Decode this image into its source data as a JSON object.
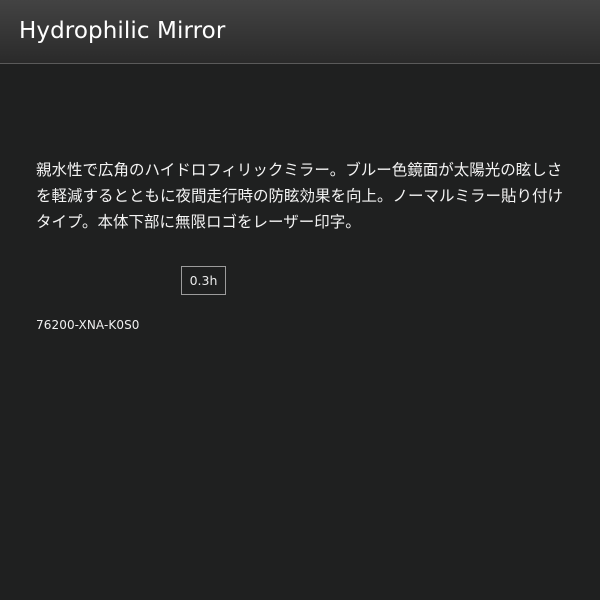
{
  "header": {
    "title": "Hydrophilic Mirror"
  },
  "product": {
    "description": "親水性で広角のハイドロフィリックミラー。ブルー色鏡面が太陽光の眩しさを軽減するとともに夜間走行時の防眩効果を向上。ノーマルミラー貼り付けタイプ。本体下部に無限ロゴをレーザー印字。",
    "time": "0.3h",
    "part_number": "76200-XNA-K0S0"
  },
  "colors": {
    "background": "#1f2020",
    "header_top": "#434343",
    "header_bottom": "#2a2a2a",
    "text": "#f2f2f2",
    "box_border": "#9c9c9c"
  }
}
